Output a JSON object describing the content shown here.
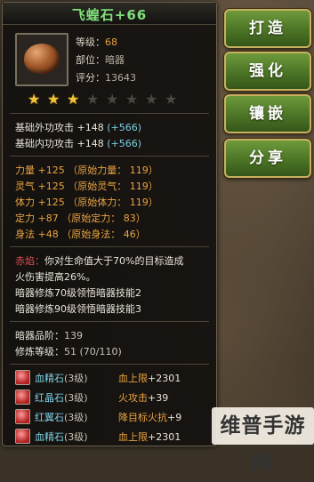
{
  "item": {
    "name": "飞蝗石",
    "enhance": "+66",
    "level_label": "等级：",
    "level_value": "68",
    "slot_label": "部位：",
    "slot_value": "暗器",
    "score_label": "评分：",
    "score_value": "13643",
    "stars_lit": 3,
    "stars_total": 8
  },
  "base_stats": [
    {
      "label": "基础外功攻击",
      "value": "+148",
      "bonus": "(+566)"
    },
    {
      "label": "基础内功攻击",
      "value": "+148",
      "bonus": "(+566)"
    }
  ],
  "attributes": [
    {
      "text": "力量 +125 （原始力量： 119）"
    },
    {
      "text": "灵气 +125 （原始灵气： 119）"
    },
    {
      "text": "体力 +125 （原始体力： 119）"
    },
    {
      "text": "定力 +87 （原始定力： 83）"
    },
    {
      "text": "身法 +48 （原始身法： 46）"
    }
  ],
  "special": {
    "tag": "赤焰：",
    "line1": "你对生命值大于70%的目标造成",
    "line2": "火伤害提高26%。",
    "skill1": "暗器修炼70级领悟暗器技能2",
    "skill2": "暗器修炼90级领悟暗器技能3"
  },
  "quality": {
    "grade_label": "暗器品阶：",
    "grade_value": "139",
    "train_label": "修炼等级：",
    "train_value": "51 (70/110)"
  },
  "gems": [
    {
      "name": "血精石",
      "level": "(3级)",
      "effect": "血上限",
      "value": "+2301"
    },
    {
      "name": "红晶石",
      "level": "(3级)",
      "effect": "火攻击",
      "value": "+39"
    },
    {
      "name": "红翼石",
      "level": "(3级)",
      "effect": "降目标火抗",
      "value": "+9"
    },
    {
      "name": "血精石",
      "level": "(3级)",
      "effect": "血上限",
      "value": "+2301"
    }
  ],
  "actions": {
    "forge": "打造",
    "enhance": "强化",
    "inlay": "镶嵌",
    "share": "分享"
  },
  "watermark": "维普手游网",
  "colors": {
    "title_green": "#7fe07a",
    "value_orange": "#e9a341",
    "bonus_cyan": "#7ed0e6",
    "button_green": "#4c7426"
  }
}
